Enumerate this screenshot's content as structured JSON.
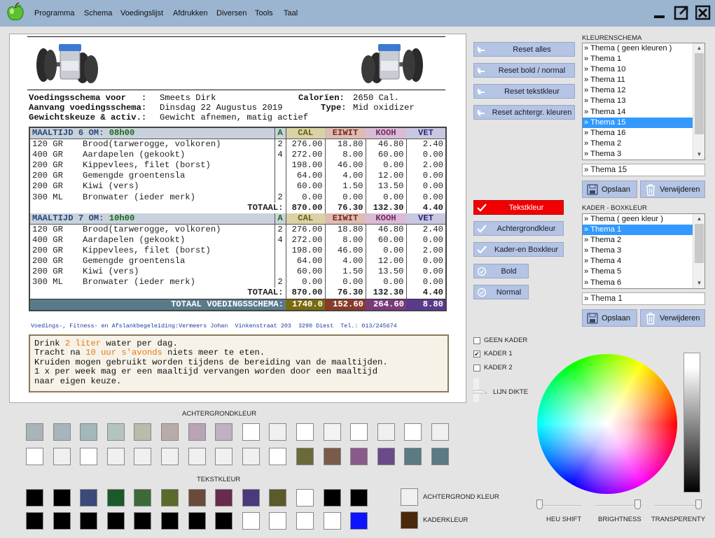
{
  "menu": [
    "Programma",
    "Schema",
    "Voedingslijst",
    "Afdrukken",
    "Diversen",
    "Tools",
    "Taal"
  ],
  "info": {
    "l1": "Voedingsschema voor   :",
    "v1": "Smeets Dirk",
    "l2": "Calorïen:",
    "v2": "2650 Cal.",
    "l3": "Aanvang voedingsschema:",
    "v3": "Dinsdag 22 Augustus 2019",
    "l4": "Type:",
    "v4": "Mid oxidizer",
    "l5": "Gewichtskeuze & activ.:",
    "v5": "Gewicht afnemen, matig actief"
  },
  "cols": {
    "a": "A",
    "cal": "CAL",
    "ew": "EIWIT",
    "kh": "KOOH",
    "vet": "VET"
  },
  "meals": [
    {
      "title": "MAALTIJD 6 OM:",
      "time": "08h00",
      "rows": [
        [
          "120 GR",
          "Brood(tarwerogge, volkoren)",
          "2",
          "276.00",
          "18.80",
          "46.80",
          "2.40"
        ],
        [
          "400 GR",
          "Aardapelen (gekookt)",
          "4",
          "272.00",
          "8.00",
          "60.00",
          "0.00"
        ],
        [
          "200 GR",
          "Kippevlees, filet (borst)",
          "",
          "198.00",
          "46.00",
          "0.00",
          "2.00"
        ],
        [
          "200 GR",
          "Gemengde groentensla",
          "",
          "64.00",
          "4.00",
          "12.00",
          "0.00"
        ],
        [
          "200 GR",
          "Kiwi (vers)",
          "",
          "60.00",
          "1.50",
          "13.50",
          "0.00"
        ],
        [
          "300 ML",
          "Bronwater (ieder merk)",
          "2",
          "0.00",
          "0.00",
          "0.00",
          "0.00"
        ]
      ],
      "total_label": "TOTAAL:",
      "total": [
        "870.00",
        "76.30",
        "132.30",
        "4.40"
      ]
    },
    {
      "title": "MAALTIJD 7 OM:",
      "time": "10h00",
      "rows": [
        [
          "120 GR",
          "Brood(tarwerogge, volkoren)",
          "2",
          "276.00",
          "18.80",
          "46.80",
          "2.40"
        ],
        [
          "400 GR",
          "Aardapelen (gekookt)",
          "4",
          "272.00",
          "8.00",
          "60.00",
          "0.00"
        ],
        [
          "200 GR",
          "Kippevlees, filet (borst)",
          "",
          "198.00",
          "46.00",
          "0.00",
          "2.00"
        ],
        [
          "200 GR",
          "Gemengde groentensla",
          "",
          "64.00",
          "4.00",
          "12.00",
          "0.00"
        ],
        [
          "200 GR",
          "Kiwi (vers)",
          "",
          "60.00",
          "1.50",
          "13.50",
          "0.00"
        ],
        [
          "300 ML",
          "Bronwater (ieder merk)",
          "2",
          "0.00",
          "0.00",
          "0.00",
          "0.00"
        ]
      ],
      "total_label": "TOTAAL:",
      "total": [
        "870.00",
        "76.30",
        "132.30",
        "4.40"
      ]
    }
  ],
  "grand": {
    "label": "TOTAAL VOEDINGSSCHEMA:",
    "cal": "1740.0",
    "ew": "152.60",
    "kh": "264.60",
    "vet": "8.80"
  },
  "footer": "Voedings-, Fitness- en Afslankbegeleiding:Vermeers Johan  Vinkenstraat 203  3290 Diest  Tel.: 013/245674",
  "notes": {
    "n1a": "Drink ",
    "n1b": "2 liter",
    "n1c": " water per dag.",
    "n2a": "Tracht na ",
    "n2b": "10 uur s'avonds",
    "n2c": " niets meer te eten.",
    "n3": "Kruiden mogen gebruikt worden tijdens de bereiding van de maaltijden.",
    "n4": "1 x per week mag er een maaltijd vervangen worden door een maaltijd",
    "n5": "naar eigen keuze."
  },
  "buttons": {
    "reset_all": "Reset alles",
    "reset_bold": "Reset bold / normal",
    "reset_text": "Reset tekstkleur",
    "reset_bg": "Reset achtergr. kleuren"
  },
  "checks": {
    "tekst": "Tekstkleur",
    "achter": "Achtergrondkleur",
    "kader": "Kader-en Boxkleur",
    "bold": "Bold",
    "normal": "Normal"
  },
  "frame": {
    "geen": "GEEN KADER",
    "k1": "KADER 1",
    "k2": "KADER 2",
    "dikte": "LIJN DIKTE",
    "k1_checked": true
  },
  "kleurenschema": {
    "title": "KLEURENSCHEMA",
    "items": [
      "» Thema ( geen kleuren )",
      "» Thema 1",
      "» Thema 10",
      "» Thema 11",
      "» Thema 12",
      "» Thema 13",
      "» Thema 14",
      "» Thema 15",
      "» Thema 16",
      "» Thema 2",
      "» Thema 3"
    ],
    "selected": 7,
    "value": "» Thema 15"
  },
  "kader": {
    "title": "KADER - BOXKLEUR",
    "items": [
      "» Thema ( geen kleur )",
      "» Thema 1",
      "» Thema 2",
      "» Thema 3",
      "» Thema 4",
      "» Thema 5",
      "» Thema 6"
    ],
    "selected": 1,
    "value": "» Thema 1"
  },
  "save": "Opslaan",
  "delete": "Verwijderen",
  "palette": {
    "bg_title": "ACHTERGRONDKLEUR",
    "txt_title": "TEKSTKLEUR",
    "bg_row1": [
      "#a9b4b8",
      "#a7b4bb",
      "#a4b8bb",
      "#b4c4bc",
      "#b8bca8",
      "#b8aca8",
      "#b8a4b4",
      "#c0b0c4",
      "#ffffff",
      "#f0f0f0",
      "#ffffff",
      "#f4f4f4",
      "#ffffff",
      "#f0f0f0",
      "#ffffff",
      "#f0f0f0"
    ],
    "bg_row2": [
      "#ffffff",
      "#f0f0f0",
      "#ffffff",
      "#f0f0f0",
      "#f0f0f0",
      "#f0f0f0",
      "#f0f0f0",
      "#f0f0f0",
      "#f0f0f0",
      "#ffffff",
      "#6a6a3a",
      "#7a5a4a",
      "#8a5a8a",
      "#6a4a8a",
      "#5a7a84",
      "#5a7a84"
    ],
    "txt_row1": [
      "#000000",
      "#000000",
      "#3a4a7a",
      "#1a5a2a",
      "#3a6a3a",
      "#5a6a2a",
      "#6a4a3a",
      "#6a2a4a",
      "#4a3a7a",
      "#5a5a2a",
      "#ffffff",
      "#000000",
      "#000000"
    ],
    "txt_row2": [
      "#000000",
      "#000000",
      "#000000",
      "#000000",
      "#000000",
      "#000000",
      "#000000",
      "#000000",
      "#ffffff",
      "#ffffff",
      "#ffffff",
      "#ffffff",
      "#0a14ff"
    ],
    "ach_label": "ACHTERGROND KLEUR",
    "kader_label": "KADERKLEUR",
    "ach_color": "#f0f0f0",
    "kader_color": "#4a2a0a"
  },
  "picker": {
    "hue": "HEU SHIFT",
    "bright": "BRIGHTNESS",
    "transp": "TRANSPERENTY",
    "hue_value": 0.0,
    "bright_value": 0.95,
    "transp_value": 1.0
  }
}
